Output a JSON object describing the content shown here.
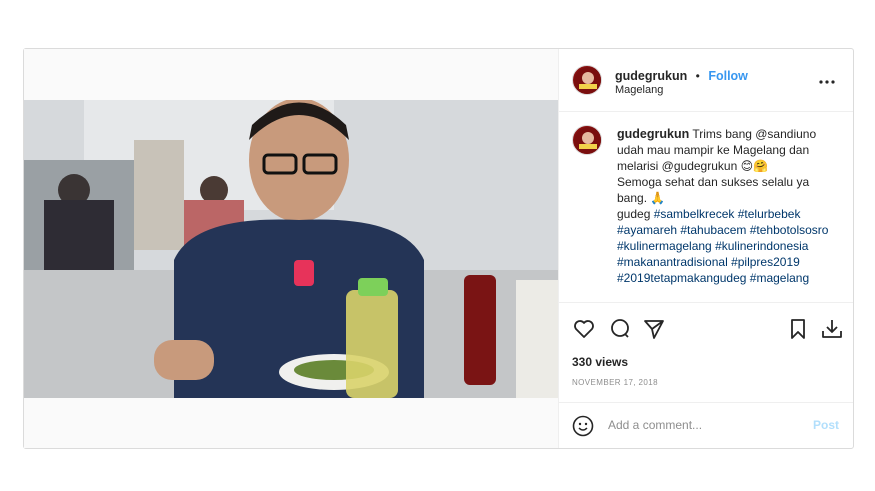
{
  "header": {
    "username": "gudegrukun",
    "separator": "•",
    "follow_label": "Follow",
    "location": "Magelang",
    "more_icon": "more-horizontal-icon"
  },
  "caption": {
    "username": "gudegrukun",
    "line1": "Trims bang @sandiuno udah mau mampir ke Magelang dan melarisi @gudegrukun 😊🤗",
    "line2": "Semoga sehat dan sukses selalu ya bang. 🙏",
    "line3_prefix": "gudeg ",
    "hashtags": "#sambelkrecek #telurbebek #ayamareh #tahubacem #tehbotolsosro #kulinermagelang #kulinerindonesia #makanantradisional #pilpres2019 #2019tetapmakangudeg #magelang"
  },
  "actions": {
    "views": "330 views",
    "date": "NOVEMBER 17, 2018",
    "icons": [
      "heart-icon",
      "comment-icon",
      "share-icon",
      "bookmark-icon",
      "download-icon"
    ]
  },
  "comment": {
    "placeholder": "Add a comment...",
    "post_label": "Post",
    "emoji_icon": "emoji-icon"
  },
  "media": {
    "mute_icon": "muted-speaker-icon"
  },
  "colors": {
    "link": "#3897f0",
    "hashtag": "#00376b",
    "border": "#dbdbdb",
    "post_disabled": "#b2dffc"
  }
}
